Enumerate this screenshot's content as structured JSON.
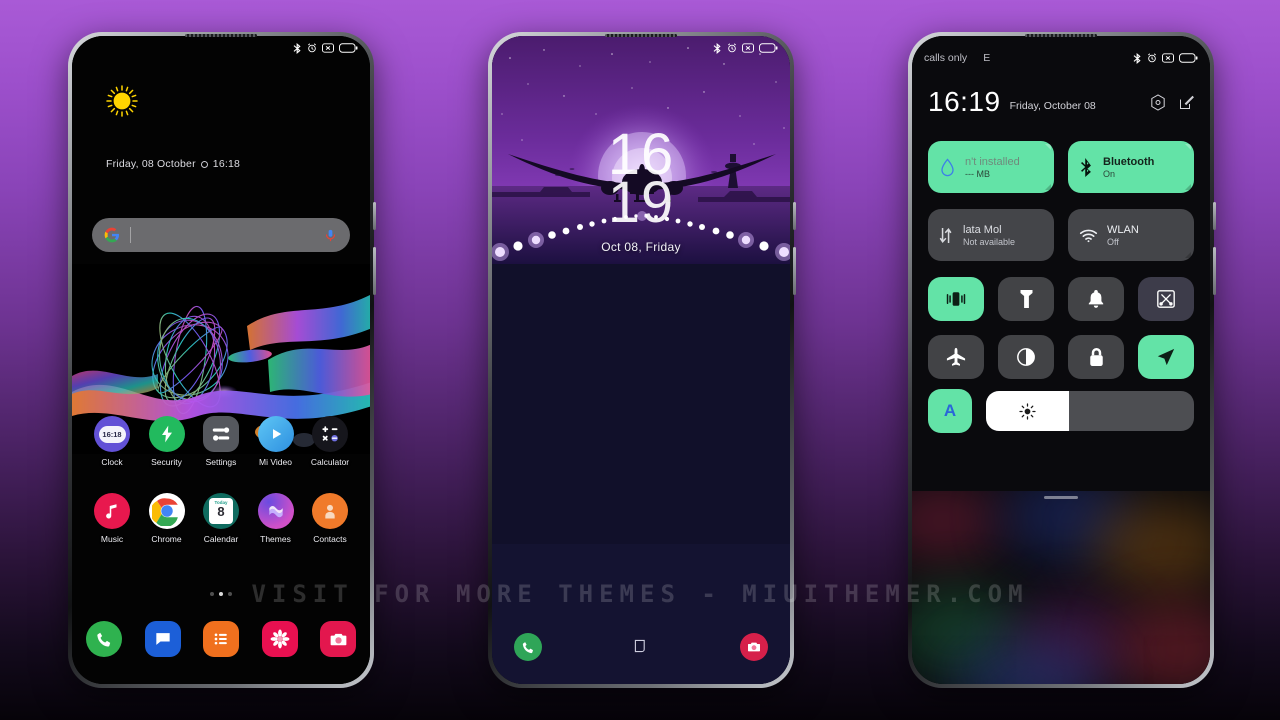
{
  "watermark": "VISIT FOR MORE THEMES - MIUITHEMER.COM",
  "colors": {
    "accent_green": "#63e3a7",
    "bg_purple_top": "#a95ad6",
    "bg_dark_bottom": "#060309",
    "tile_off": "rgba(150,152,158,0.40)"
  },
  "phone1": {
    "name": "home-screen",
    "statusbar": {
      "left": "",
      "icons": [
        "bluetooth-icon",
        "alarm-icon",
        "dnd-icon",
        "battery-icon"
      ]
    },
    "weather_icon": "sun-icon",
    "date_line": {
      "day_date": "Friday, 08 October",
      "separator": "circle-dot",
      "time": "16:18"
    },
    "search": {
      "placeholder": "",
      "left_icon": "google-g-icon",
      "right_icon": "microphone-icon"
    },
    "apps_row1": [
      {
        "label": "Clock",
        "icon": "clock-icon",
        "badge": "16:18"
      },
      {
        "label": "Security",
        "icon": "security-icon"
      },
      {
        "label": "Settings",
        "icon": "settings-icon"
      },
      {
        "label": "Mi Video",
        "icon": "play-icon"
      },
      {
        "label": "Calculator",
        "icon": "calculator-icon"
      }
    ],
    "apps_row2": [
      {
        "label": "Music",
        "icon": "music-note-icon"
      },
      {
        "label": "Chrome",
        "icon": "chrome-icon"
      },
      {
        "label": "Calendar",
        "icon": "calendar-icon",
        "day": "8",
        "month": "Today"
      },
      {
        "label": "Themes",
        "icon": "themes-icon"
      },
      {
        "label": "Contacts",
        "icon": "contacts-icon"
      }
    ],
    "dock": [
      {
        "label": "Phone",
        "icon": "phone-icon"
      },
      {
        "label": "Messages",
        "icon": "message-icon"
      },
      {
        "label": "Notes",
        "icon": "notes-icon"
      },
      {
        "label": "Gallery",
        "icon": "flower-icon"
      },
      {
        "label": "Camera",
        "icon": "camera-icon"
      }
    ]
  },
  "phone2": {
    "name": "lock-screen",
    "statusbar": {
      "icons": [
        "bluetooth-icon",
        "alarm-icon",
        "dnd-icon",
        "battery-icon"
      ]
    },
    "clock_hours": "16",
    "clock_minutes": "19",
    "date": "Oct 08, Friday",
    "shortcuts": {
      "left": "phone-icon",
      "center": "lock-icon",
      "right": "camera-icon"
    }
  },
  "phone3": {
    "name": "quick-settings",
    "statusbar": {
      "carrier": "calls only",
      "network": "E",
      "icons": [
        "bluetooth-icon",
        "alarm-icon",
        "dnd-icon",
        "battery-icon"
      ]
    },
    "clock": "16:19",
    "date": "Friday, October 08",
    "header_icons": [
      "settings-gear-icon",
      "edit-icon"
    ],
    "big_tiles": [
      {
        "title": "n't installed",
        "subtitle": "--- MB",
        "state": "on",
        "icon": "data-usage-drop-icon"
      },
      {
        "title": "Bluetooth",
        "subtitle": "On",
        "state": "on",
        "icon": "bluetooth-icon"
      },
      {
        "title": "lata      Mol",
        "subtitle": "Not available",
        "state": "off",
        "icon": "mobile-data-icon"
      },
      {
        "title": "WLAN",
        "subtitle": "Off",
        "state": "off",
        "icon": "wifi-icon"
      }
    ],
    "toggle_tiles": [
      {
        "name": "vibrate",
        "icon": "vibrate-icon",
        "state": "on"
      },
      {
        "name": "flashlight",
        "icon": "flashlight-icon",
        "state": "off"
      },
      {
        "name": "ringer",
        "icon": "bell-icon",
        "state": "off"
      },
      {
        "name": "screenshot",
        "icon": "scissors-icon",
        "state": "off"
      },
      {
        "name": "airplane",
        "icon": "airplane-icon",
        "state": "off"
      },
      {
        "name": "dark-mode",
        "icon": "contrast-icon",
        "state": "off"
      },
      {
        "name": "lock",
        "icon": "lock-icon",
        "state": "off"
      },
      {
        "name": "location",
        "icon": "location-arrow-icon",
        "state": "on"
      }
    ],
    "brightness": {
      "auto_label": "A",
      "icon": "brightness-sun-icon",
      "value_percent": 40
    }
  }
}
